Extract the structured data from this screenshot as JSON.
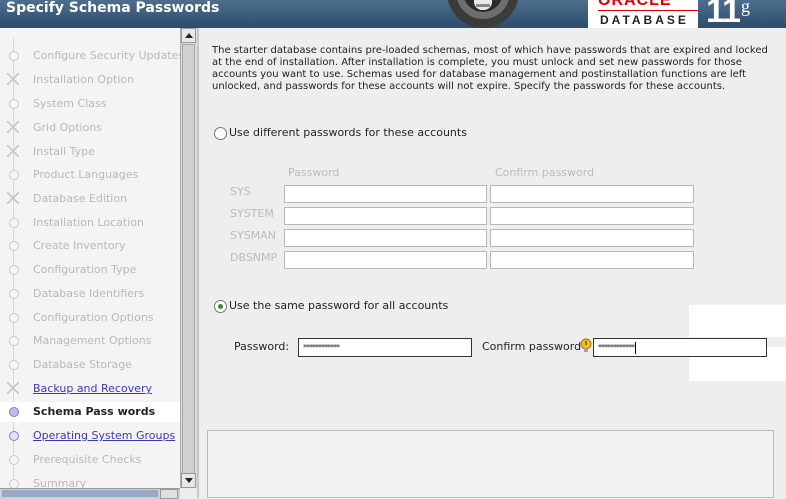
{
  "window": {
    "title": "Specify Schema Passwords"
  },
  "branding": {
    "oracle": "ORACLE",
    "database": "DATABASE",
    "version": "11",
    "version_suffix": "g"
  },
  "sidebar": {
    "steps": [
      {
        "label": "Configure Security Updates",
        "state": "pending"
      },
      {
        "label": "Installation Option",
        "state": "pending"
      },
      {
        "label": "System Class",
        "state": "pending"
      },
      {
        "label": "Grid Options",
        "state": "pending"
      },
      {
        "label": "Install Type",
        "state": "pending"
      },
      {
        "label": "Product Languages",
        "state": "pending"
      },
      {
        "label": "Database Edition",
        "state": "pending"
      },
      {
        "label": "Installation Location",
        "state": "pending"
      },
      {
        "label": "Create Inventory",
        "state": "pending"
      },
      {
        "label": "Configuration Type",
        "state": "pending"
      },
      {
        "label": "Database Identifiers",
        "state": "pending"
      },
      {
        "label": "Configuration Options",
        "state": "pending"
      },
      {
        "label": "Management Options",
        "state": "pending"
      },
      {
        "label": "Database Storage",
        "state": "pending"
      },
      {
        "label": "Backup and Recovery",
        "state": "done"
      },
      {
        "label": "Schema Pass words",
        "state": "current"
      },
      {
        "label": "Operating System Groups",
        "state": "done"
      },
      {
        "label": "Prerequisite Checks",
        "state": "pending"
      },
      {
        "label": "Summary",
        "state": "pending"
      }
    ]
  },
  "main": {
    "intro": "The starter database contains pre-loaded schemas, most of which have passwords that are expired and locked at the end of installation. After installation is complete, you must unlock and set new passwords for those accounts you want to use. Schemas used for database management and postinstallation functions are left unlocked, and passwords for these accounts will not expire. Specify the passwords for these accounts.",
    "option_different": {
      "label": "Use different passwords for these accounts",
      "selected": false
    },
    "table": {
      "headers": [
        "Password",
        "Confirm password"
      ],
      "accounts": [
        "SYS",
        "SYSTEM",
        "SYSMAN",
        "DBSNMP"
      ]
    },
    "option_same": {
      "label": "Use the same password for all accounts",
      "selected": true
    },
    "password_label": "Password:",
    "password_value": "************",
    "confirm_label": "Confirm password",
    "confirm_value": "************"
  },
  "colors": {
    "header": "#3d5d7d",
    "oracle_red": "#dd0000",
    "link": "#3a3ab0",
    "radio_on": "#3a8a3a"
  }
}
